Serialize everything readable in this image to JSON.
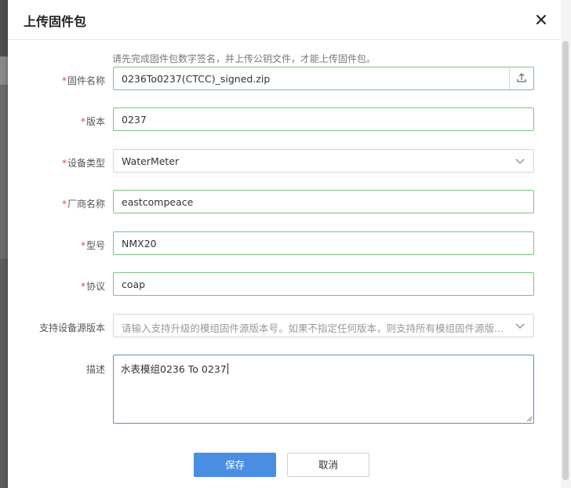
{
  "dialog": {
    "title": "上传固件包",
    "hint": "请先完成固件包数字签名，并上传公钥文件，才能上传固件包。"
  },
  "form": {
    "required_mark": "*",
    "firmware_name": {
      "label": "固件名称",
      "value": "0236To0237(CTCC)_signed.zip"
    },
    "version": {
      "label": "版本",
      "value": "0237"
    },
    "device_type": {
      "label": "设备类型",
      "value": "WaterMeter"
    },
    "vendor_name": {
      "label": "厂商名称",
      "value": "eastcompeace"
    },
    "model": {
      "label": "型号",
      "value": "NMX20"
    },
    "protocol": {
      "label": "协议",
      "value": "coap"
    },
    "source_version": {
      "label": "支持设备源版本",
      "placeholder": "请输入支持升级的模组固件源版本号。如果不指定任何版本，则支持所有模组固件源版..."
    },
    "description": {
      "label": "描述",
      "value": "水表模组0236 To 0237"
    }
  },
  "buttons": {
    "save": "保存",
    "cancel": "取消"
  },
  "icons": {
    "close": "close-icon",
    "upload": "upload-icon",
    "dropdown": "chevron-down-icon"
  },
  "colors": {
    "primary": "#4a8ee3",
    "valid_border": "#7cc47f",
    "focus_border": "#5b8fd9",
    "required": "#e2493b"
  }
}
